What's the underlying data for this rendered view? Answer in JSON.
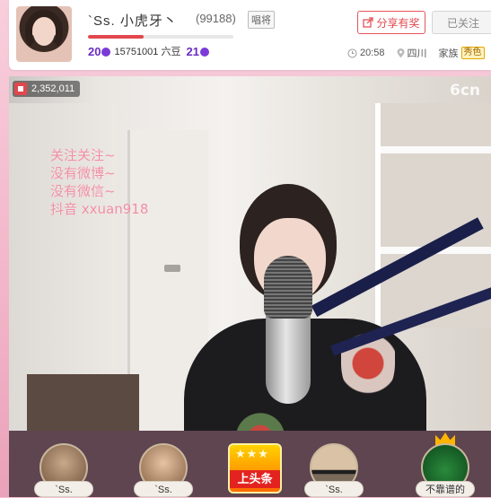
{
  "header": {
    "room_name": "`Ss. 小虎牙丶",
    "room_id": "(99188)",
    "sing_badge": "唱将",
    "progress_fraction": 0.38,
    "level_start": "20",
    "points_text": "15751001 六豆",
    "level_end": "21",
    "share_label": "分享有奖",
    "follow_label": "已关注",
    "time": "20:58",
    "location": "四川",
    "family_label": "家族",
    "xiu_badge": "秀色"
  },
  "video": {
    "viewer_count": "2,352,011",
    "watermark": "6cn",
    "overlay_lines": [
      "关注关注~",
      "没有微博~",
      "没有微信~",
      "抖音 xxuan918"
    ]
  },
  "bottom": {
    "cards": [
      {
        "label": "`Ss."
      },
      {
        "label": "`Ss."
      },
      {
        "label": "`Ss."
      },
      {
        "label": "不靠谱的"
      }
    ],
    "headline_label": "上头条"
  },
  "colors": {
    "accent_red": "#e2474d",
    "level_purple": "#6a2cc4",
    "overlay_pink": "#f08ca3"
  }
}
